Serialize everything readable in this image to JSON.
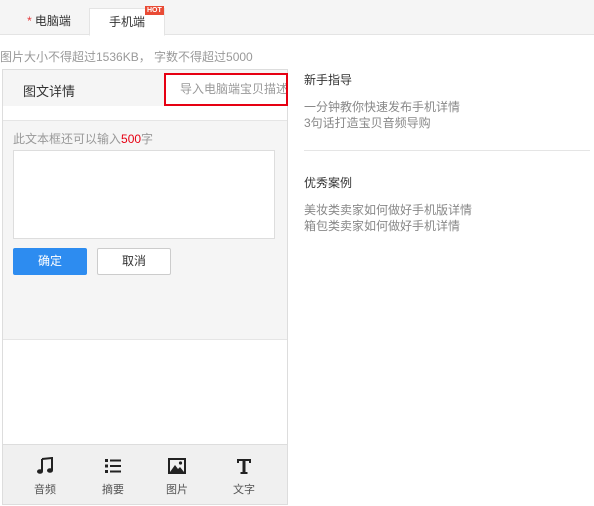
{
  "tabs": {
    "pc_star": "*",
    "pc_label": "电脑端",
    "mobile_label": "手机端",
    "hot_badge": "HOT"
  },
  "notice": "图片大小不得超过1536KB， 字数不得超过5000",
  "editor": {
    "title": "图文详情",
    "import_label": "导入电脑端宝贝描述",
    "remain_prefix": "此文本框还可以输入",
    "remain_count": "500",
    "remain_suffix": "字",
    "textarea_value": "",
    "confirm_label": "确定",
    "cancel_label": "取消"
  },
  "toolbar": {
    "items": [
      {
        "label": "音频",
        "icon": "music-note-icon"
      },
      {
        "label": "摘要",
        "icon": "list-icon"
      },
      {
        "label": "图片",
        "icon": "image-icon"
      },
      {
        "label": "文字",
        "icon": "text-t-icon"
      }
    ]
  },
  "side": {
    "guide_title": "新手指导",
    "guide_links": [
      "一分钟教你快速发布手机详情",
      "3句话打造宝贝音频导购"
    ],
    "cases_title": "优秀案例",
    "cases_links": [
      "美妆类卖家如何做好手机版详情",
      "箱包类卖家如何做好手机详情"
    ]
  },
  "colors": {
    "accent_blue": "#2d8cf0",
    "highlight_red": "#e60012",
    "hot_badge": "#e94b35"
  }
}
